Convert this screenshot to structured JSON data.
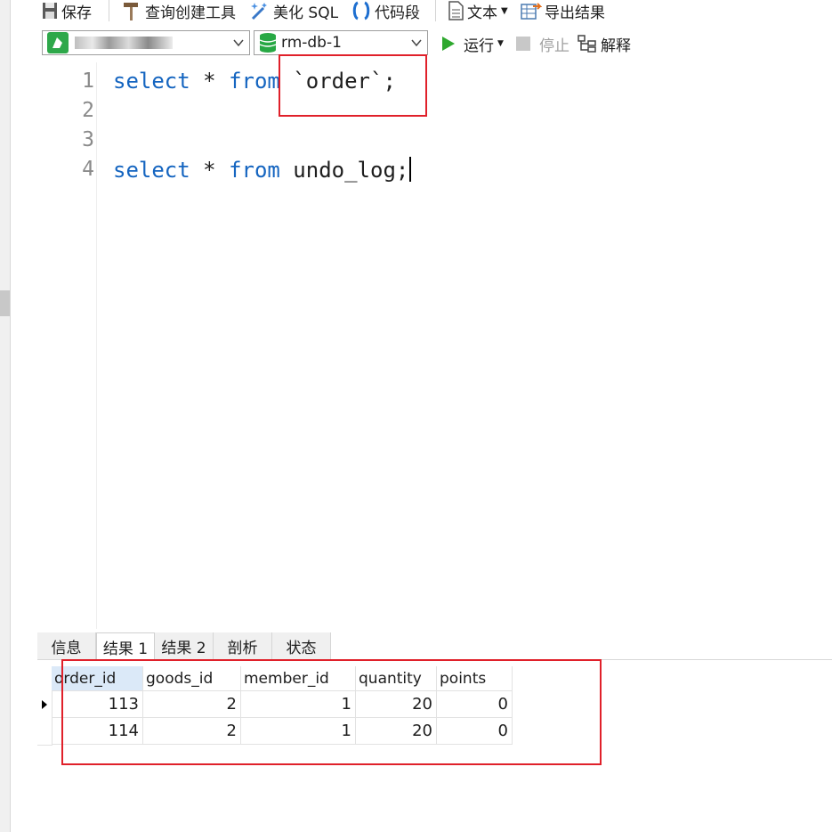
{
  "toolbar": {
    "save_label": "保存",
    "query_builder_label": "查询创建工具",
    "beautify_label": "美化 SQL",
    "snippet_label": "代码段",
    "text_label": "文本",
    "export_label": "导出结果",
    "run_label": "运行",
    "stop_label": "停止",
    "explain_label": "解释"
  },
  "connection": {
    "name": ""
  },
  "database": {
    "name": "rm-db-1"
  },
  "editor": {
    "line_numbers": [
      "1",
      "2",
      "3",
      "4"
    ],
    "lines": [
      {
        "kw1": "select",
        "mid": " * ",
        "kw2": "from",
        "rest": " `order`;"
      },
      {
        "kw1": "",
        "mid": "",
        "kw2": "",
        "rest": ""
      },
      {
        "kw1": "",
        "mid": "",
        "kw2": "",
        "rest": ""
      },
      {
        "kw1": "select",
        "mid": " * ",
        "kw2": "from",
        "rest": " undo_log;"
      }
    ]
  },
  "result_tabs": [
    "信息",
    "结果 1",
    "结果 2",
    "剖析",
    "状态"
  ],
  "active_tab": "结果 1",
  "result_grid": {
    "columns": [
      "order_id",
      "goods_id",
      "member_id",
      "quantity",
      "points"
    ],
    "rows": [
      [
        "113",
        "2",
        "1",
        "20",
        "0"
      ],
      [
        "114",
        "2",
        "1",
        "20",
        "0"
      ]
    ]
  },
  "colors": {
    "keyword": "#1565c0",
    "highlight_box": "#e0202a",
    "run_green": "#2ea82e",
    "db_green": "#27a844"
  },
  "icons": [
    "save-icon",
    "hammer-icon",
    "magic-wand-icon",
    "braces-icon",
    "document-icon",
    "export-icon",
    "connection-icon",
    "database-icon",
    "play-icon",
    "stop-icon",
    "explain-icon",
    "row-pointer-icon"
  ]
}
